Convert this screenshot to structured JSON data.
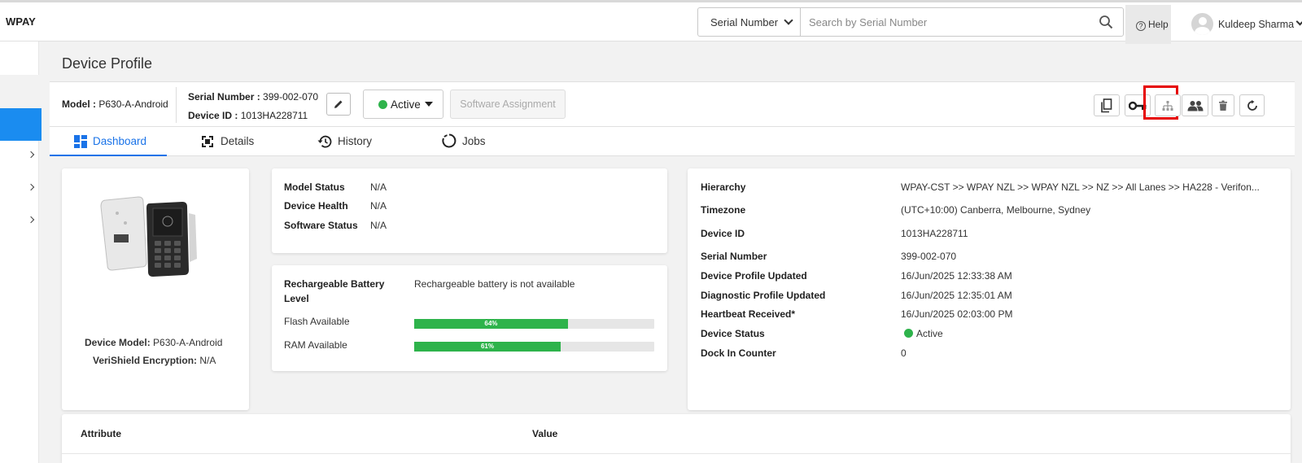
{
  "app": {
    "brand": "WPAY"
  },
  "search": {
    "type_label": "Serial Number",
    "placeholder": "Search by Serial Number"
  },
  "header": {
    "help_label": "Help",
    "user_name": "Kuldeep Sharma"
  },
  "page": {
    "title": "Device Profile"
  },
  "toolbar": {
    "model_label": "Model :",
    "model_value": "P630-A-Android",
    "serial_label": "Serial Number :",
    "serial_value": "399-002-070",
    "device_id_label": "Device ID :",
    "device_id_value": "1013HA228711",
    "status_label": "Active",
    "software_assignment_label": "Software Assignment"
  },
  "tabs": [
    {
      "label": "Dashboard"
    },
    {
      "label": "Details"
    },
    {
      "label": "History"
    },
    {
      "label": "Jobs"
    }
  ],
  "device_card": {
    "model_label": "Device Model:",
    "model_value": "P630-A-Android",
    "encryption_label": "VeriShield Encryption:",
    "encryption_value": "N/A"
  },
  "status_card": {
    "rows": [
      {
        "label": "Model Status",
        "value": "N/A"
      },
      {
        "label": "Device Health",
        "value": "N/A"
      },
      {
        "label": "Software Status",
        "value": "N/A"
      }
    ]
  },
  "resources_card": {
    "battery_label_1": "Rechargeable Battery",
    "battery_label_2": "Level",
    "battery_value": "Rechargeable battery is not available",
    "flash_label": "Flash Available",
    "flash_percent": 64,
    "flash_text": "64%",
    "ram_label": "RAM Available",
    "ram_percent": 61,
    "ram_text": "61%"
  },
  "info_card": {
    "rows": [
      {
        "label": "Hierarchy",
        "value": "WPAY-CST >> WPAY NZL >> WPAY NZL >> NZ >> All Lanes >> HA228 - Verifon..."
      },
      {
        "label": "Timezone",
        "value": "(UTC+10:00) Canberra, Melbourne, Sydney"
      },
      {
        "label": "Device ID",
        "value": "1013HA228711"
      },
      {
        "label": "Serial Number",
        "value": "399-002-070"
      },
      {
        "label": "Device Profile Updated",
        "value": "16/Jun/2025 12:33:38 AM"
      },
      {
        "label": "Diagnostic Profile Updated",
        "value": "16/Jun/2025 12:35:01 AM"
      },
      {
        "label": "Heartbeat Received*",
        "value": "16/Jun/2025 02:03:00 PM"
      },
      {
        "label": "Device Status",
        "value": "Active"
      },
      {
        "label": "Dock In Counter",
        "value": "0"
      }
    ]
  },
  "attribute_table": {
    "col_attribute": "Attribute",
    "col_value": "Value"
  },
  "colors": {
    "accent": "#1a8cf0",
    "active_green": "#2eb34b",
    "highlight_red": "#e60000"
  }
}
